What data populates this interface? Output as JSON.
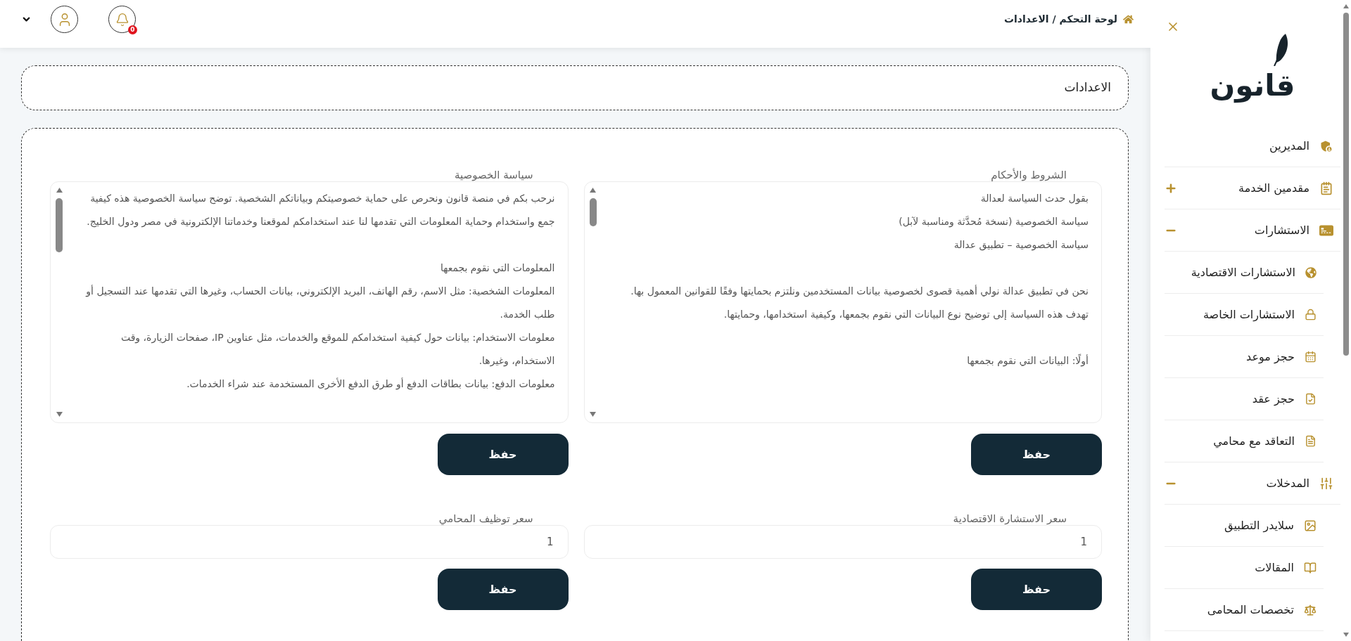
{
  "topbar": {
    "breadcrumb": "لوحة التحكم / الاعدادات",
    "notification_count": "0"
  },
  "page_title": "الاعدادات",
  "text_fields": [
    {
      "label": "الشروط والأحكام",
      "blocks": [
        [
          "بقول حدث السياسة لعدالة",
          "سياسة الخصوصية (نسخة مُحدَّثة ومناسبة لآبل)",
          "سياسة الخصوصية – تطبيق عدالة"
        ],
        [
          "نحن في تطبيق عدالة نولي أهمية قصوى لخصوصية بيانات المستخدمين ونلتزم بحمايتها وفقًا للقوانين المعمول بها. تهدف هذه السياسة إلى توضيح نوع البيانات التي نقوم بجمعها، وكيفية استخدامها، وحمايتها."
        ],
        [
          "أولًا: البيانات التي نقوم بجمعها"
        ]
      ],
      "button": "حفظ"
    },
    {
      "label": "سياسة الخصوصية",
      "blocks": [
        [
          "نرحب بكم في منصة قانون ونحرص على حماية خصوصيتكم وبياناتكم الشخصية. توضح سياسة الخصوصية هذه كيفية جمع واستخدام وحماية المعلومات التي تقدمها لنا عند استخدامكم لموقعنا وخدماتنا الإلكترونية في مصر ودول الخليج."
        ],
        [
          "المعلومات التي نقوم بجمعها",
          "المعلومات الشخصية: مثل الاسم، رقم الهاتف، البريد الإلكتروني، بيانات الحساب، وغيرها التي تقدمها عند التسجيل أو طلب الخدمة.",
          "معلومات الاستخدام: بيانات حول كيفية استخدامكم للموقع والخدمات، مثل عناوين IP، صفحات الزيارة، وقت الاستخدام، وغيرها.",
          "معلومات الدفع: بيانات بطاقات الدفع أو طرق الدفع الأخرى المستخدمة عند شراء الخدمات."
        ]
      ],
      "button": "حفظ"
    }
  ],
  "price_fields": [
    {
      "label": "سعر الاستشارة الاقتصادية",
      "value": "1",
      "button": "حفظ"
    },
    {
      "label": "سعر توظيف المحامي",
      "value": "1",
      "button": "حفظ"
    }
  ],
  "sidebar": {
    "logo": "قانون",
    "items": [
      {
        "label": "المديرين",
        "selected": false
      },
      {
        "label": "مقدمين الخدمة",
        "selected": false,
        "expanded": false
      },
      {
        "label": "الاستشارات",
        "selected": false,
        "expanded": true,
        "children": [
          {
            "label": "الاستشارات الاقتصادية",
            "selected": false
          },
          {
            "label": "الاستشارات الخاصة",
            "selected": false
          },
          {
            "label": "حجز موعد",
            "selected": false
          },
          {
            "label": "حجز عقد",
            "selected": false
          },
          {
            "label": "التعاقد مع محامي",
            "selected": false
          }
        ]
      },
      {
        "label": "المدخلات",
        "selected": false,
        "expanded": true,
        "children": [
          {
            "label": "سلايدر التطبيق",
            "selected": false
          },
          {
            "label": "المقالات",
            "selected": false
          },
          {
            "label": "تخصصات المحامى",
            "selected": false
          }
        ]
      }
    ]
  }
}
